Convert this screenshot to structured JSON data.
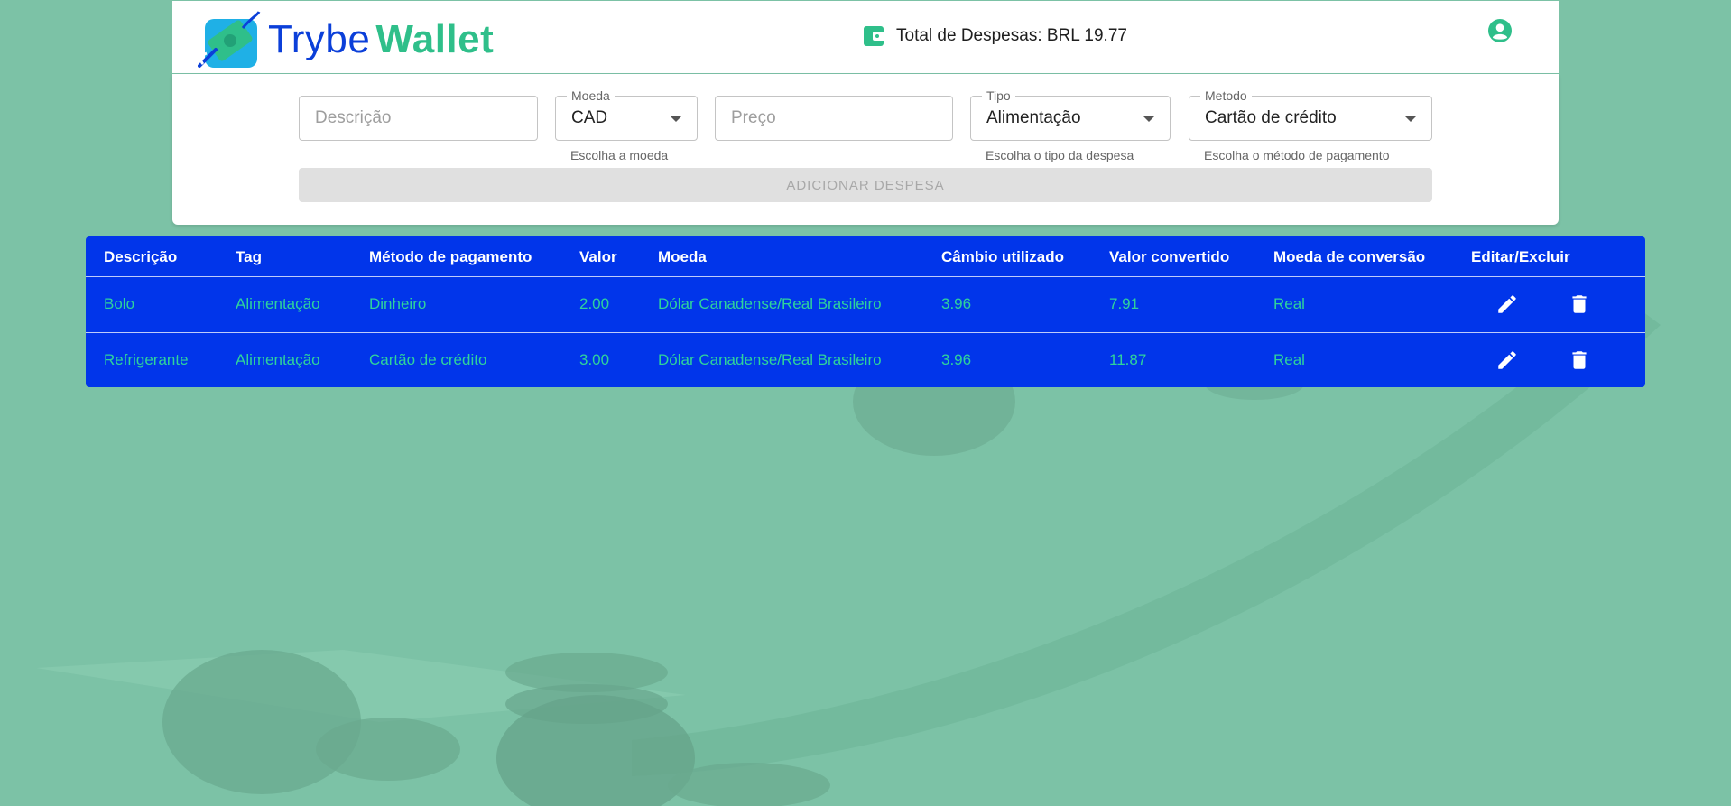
{
  "header": {
    "logo_trybe": "Trybe",
    "logo_wallet": "Wallet",
    "total_label": "Total de Despesas: BRL 19.77"
  },
  "form": {
    "description_placeholder": "Descrição",
    "currency_label": "Moeda",
    "currency_value": "CAD",
    "currency_helper": "Escolha a moeda",
    "price_placeholder": "Preço",
    "tag_label": "Tipo",
    "tag_value": "Alimentação",
    "tag_helper": "Escolha o tipo da despesa",
    "method_label": "Metodo",
    "method_value": "Cartão de crédito",
    "method_helper": "Escolha o método de pagamento",
    "add_button": "ADICIONAR DESPESA"
  },
  "table": {
    "headers": [
      "Descrição",
      "Tag",
      "Método de pagamento",
      "Valor",
      "Moeda",
      "Câmbio utilizado",
      "Valor convertido",
      "Moeda de conversão",
      "Editar/Excluir"
    ],
    "rows": [
      {
        "description": "Bolo",
        "tag": "Alimentação",
        "method": "Dinheiro",
        "value": "2.00",
        "currency": "Dólar Canadense/Real Brasileiro",
        "rate": "3.96",
        "converted": "7.91",
        "conversion_currency": "Real"
      },
      {
        "description": "Refrigerante",
        "tag": "Alimentação",
        "method": "Cartão de crédito",
        "value": "3.00",
        "currency": "Dólar Canadense/Real Brasileiro",
        "rate": "3.96",
        "converted": "11.87",
        "conversion_currency": "Real"
      }
    ]
  },
  "icons": {
    "logo": "wallet-logo-icon",
    "total": "wallet-icon",
    "avatar": "account-circle-icon",
    "edit": "pencil-icon",
    "delete": "trash-icon"
  },
  "colors": {
    "background": "#7cc2a6",
    "brand_blue": "#0b3fd9",
    "brand_green": "#2fbf8a",
    "table_bg": "#0135ea",
    "table_text": "#2fd39b"
  }
}
